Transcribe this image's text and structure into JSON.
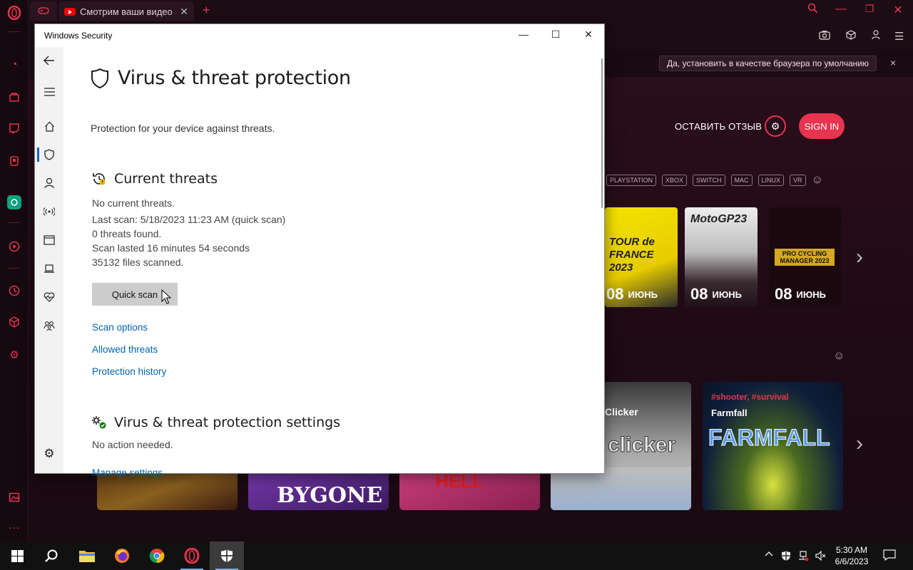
{
  "browser": {
    "tabs": [
      {
        "title": "Смотрим ваши видео с M"
      }
    ],
    "default_banner": {
      "button_label": "Да, установить в качестве браузера по умолчанию",
      "close_symbol": "×"
    },
    "content": {
      "feedback_label": "ОСТАВИТЬ ОТЗЫВ",
      "signin_label": "SIGN IN",
      "platforms": [
        "PLAYSTATION",
        "XBOX",
        "SWITCH",
        "MAC",
        "LINUX",
        "VR"
      ],
      "release_cards": [
        {
          "art_text": "TOUR de FRANCE 2023",
          "day": "08",
          "month": "ИЮНЬ"
        },
        {
          "art_text": "MotoGP23",
          "day": "08",
          "month": "ИЮНЬ"
        },
        {
          "art_text": "PRO CYCLING MANAGER 2023",
          "day": "08",
          "month": "ИЮНЬ"
        }
      ],
      "featured_cards": [
        {
          "title": "Clicker",
          "art_text": "clicker"
        },
        {
          "tags": "#shooter, #survival",
          "title": "Farmfall",
          "art_text": "FARMFALL"
        }
      ],
      "bottom_cards": [
        {
          "art_text": ""
        },
        {
          "art_text": "BYGONE"
        },
        {
          "art_text": "HELL"
        },
        {
          "art_text": ""
        }
      ]
    }
  },
  "window": {
    "title": "Windows Security",
    "page_title": "Virus & threat protection",
    "page_subtitle": "Protection for your device against threats.",
    "current_threats": {
      "heading": "Current threats",
      "status": "No current threats.",
      "last_scan": "Last scan: 5/18/2023 11:23 AM (quick scan)",
      "threats_found": "0 threats found.",
      "scan_duration": "Scan lasted 16 minutes 54 seconds",
      "files_scanned": "35132 files scanned.",
      "quick_scan_label": "Quick scan",
      "links": [
        "Scan options",
        "Allowed threats",
        "Protection history"
      ]
    },
    "settings_section": {
      "heading": "Virus & threat protection settings",
      "status": "No action needed.",
      "link": "Manage settings"
    }
  },
  "taskbar": {
    "clock_time": "5:30 AM",
    "clock_date": "6/6/2023"
  },
  "colors": {
    "opera_accent": "#e8344f",
    "link_blue": "#0063b1",
    "nav_highlight": "#0067c0"
  },
  "icons": {
    "opera_sidebar": [
      "opera-logo-icon",
      "speed-dial-icon",
      "shopping-icon",
      "twitch-icon",
      "gaming-icon",
      "chatgpt-icon",
      "player-icon",
      "history-icon",
      "extensions-icon",
      "settings-icon",
      "gallery-icon",
      "more-icon"
    ],
    "ws_nav": [
      "back-icon",
      "menu-icon",
      "home-icon",
      "shield-icon",
      "account-icon",
      "firewall-icon",
      "app-browser-icon",
      "device-security-icon",
      "health-icon",
      "family-icon",
      "settings-icon"
    ]
  }
}
